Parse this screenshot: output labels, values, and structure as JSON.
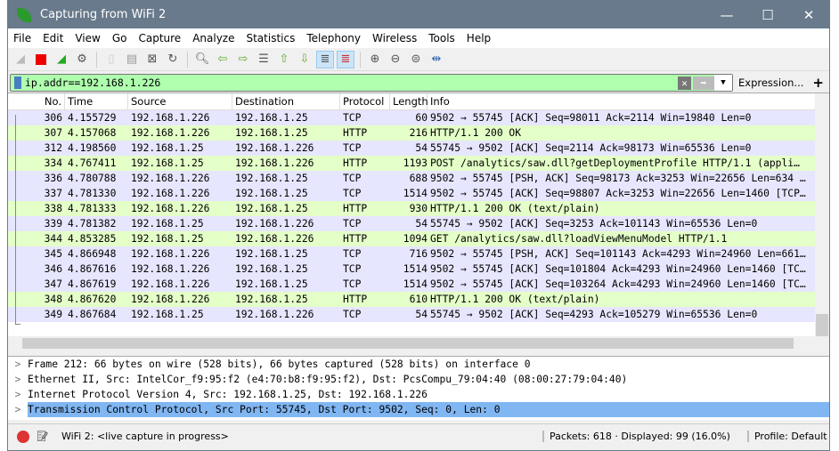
{
  "window": {
    "title": "Capturing from WiFi 2"
  },
  "menu": [
    "File",
    "Edit",
    "View",
    "Go",
    "Capture",
    "Analyze",
    "Statistics",
    "Telephony",
    "Wireless",
    "Tools",
    "Help"
  ],
  "filter": {
    "value": "ip.addr==192.168.1.226",
    "expression_label": "Expression...",
    "add_label": "+"
  },
  "columns": [
    "No.",
    "Time",
    "Source",
    "Destination",
    "Protocol",
    "Length",
    "Info"
  ],
  "colors": {
    "tcp_row": "#e7e6ff",
    "http_row": "#e4ffc7",
    "filter_ok": "#afffaf",
    "selected": "#80b6f2",
    "titlebar": "#687a8c"
  },
  "packets": [
    [
      "306",
      "4.155729",
      "192.168.1.226",
      "192.168.1.25",
      "TCP",
      "60",
      "9502 → 55745 [ACK] Seq=98011 Ack=2114 Win=19840 Len=0"
    ],
    [
      "307",
      "4.157068",
      "192.168.1.226",
      "192.168.1.25",
      "HTTP",
      "216",
      "HTTP/1.1 200 OK"
    ],
    [
      "312",
      "4.198560",
      "192.168.1.25",
      "192.168.1.226",
      "TCP",
      "54",
      "55745 → 9502 [ACK] Seq=2114 Ack=98173 Win=65536 Len=0"
    ],
    [
      "334",
      "4.767411",
      "192.168.1.25",
      "192.168.1.226",
      "HTTP",
      "1193",
      "POST /analytics/saw.dll?getDeploymentProfile HTTP/1.1  (appli…"
    ],
    [
      "336",
      "4.780788",
      "192.168.1.226",
      "192.168.1.25",
      "TCP",
      "688",
      "9502 → 55745 [PSH, ACK] Seq=98173 Ack=3253 Win=22656 Len=634 …"
    ],
    [
      "337",
      "4.781330",
      "192.168.1.226",
      "192.168.1.25",
      "TCP",
      "1514",
      "9502 → 55745 [ACK] Seq=98807 Ack=3253 Win=22656 Len=1460 [TCP…"
    ],
    [
      "338",
      "4.781333",
      "192.168.1.226",
      "192.168.1.25",
      "HTTP",
      "930",
      "HTTP/1.1 200 OK  (text/plain)"
    ],
    [
      "339",
      "4.781382",
      "192.168.1.25",
      "192.168.1.226",
      "TCP",
      "54",
      "55745 → 9502 [ACK] Seq=3253 Ack=101143 Win=65536 Len=0"
    ],
    [
      "344",
      "4.853285",
      "192.168.1.25",
      "192.168.1.226",
      "HTTP",
      "1094",
      "GET /analytics/saw.dll?loadViewMenuModel HTTP/1.1"
    ],
    [
      "345",
      "4.866948",
      "192.168.1.226",
      "192.168.1.25",
      "TCP",
      "716",
      "9502 → 55745 [PSH, ACK] Seq=101143 Ack=4293 Win=24960 Len=661…"
    ],
    [
      "346",
      "4.867616",
      "192.168.1.226",
      "192.168.1.25",
      "TCP",
      "1514",
      "9502 → 55745 [ACK] Seq=101804 Ack=4293 Win=24960 Len=1460 [TC…"
    ],
    [
      "347",
      "4.867619",
      "192.168.1.226",
      "192.168.1.25",
      "TCP",
      "1514",
      "9502 → 55745 [ACK] Seq=103264 Ack=4293 Win=24960 Len=1460 [TC…"
    ],
    [
      "348",
      "4.867620",
      "192.168.1.226",
      "192.168.1.25",
      "HTTP",
      "610",
      "HTTP/1.1 200 OK  (text/plain)"
    ],
    [
      "349",
      "4.867684",
      "192.168.1.25",
      "192.168.1.226",
      "TCP",
      "54",
      "55745 → 9502 [ACK] Seq=4293 Ack=105279 Win=65536 Len=0"
    ]
  ],
  "details": [
    "Frame 212: 66 bytes on wire (528 bits), 66 bytes captured (528 bits) on interface 0",
    "Ethernet II, Src: IntelCor_f9:95:f2 (e4:70:b8:f9:95:f2), Dst: PcsCompu_79:04:40 (08:00:27:79:04:40)",
    "Internet Protocol Version 4, Src: 192.168.1.25, Dst: 192.168.1.226",
    "Transmission Control Protocol, Src Port: 55745, Dst Port: 9502, Seq: 0, Len: 0"
  ],
  "status": {
    "capture": "WiFi 2: <live capture in progress>",
    "packets": "Packets: 618 · Displayed: 99 (16.0%)",
    "profile": "Profile: Default"
  }
}
